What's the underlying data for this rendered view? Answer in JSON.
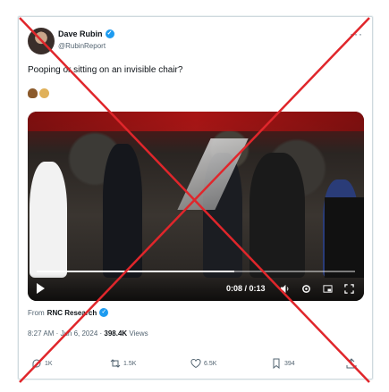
{
  "post": {
    "author": "Dave Rubin",
    "handle": "@RubinReport",
    "more": "···",
    "text": "Pooping or sitting on an invisible chair?",
    "emojis": [
      "poop-emoji",
      "person-emoji"
    ]
  },
  "video": {
    "time": "0:08 / 0:13",
    "progress": 0.62
  },
  "source": {
    "prefix": "From",
    "name": "RNC Research"
  },
  "meta": {
    "time": "8:27 AM",
    "date": "Jun 6, 2024",
    "views_count": "398.4K",
    "views_label": "Views"
  },
  "actions": {
    "replies": "1K",
    "reposts": "1.5K",
    "likes": "6.5K",
    "bookmarks": "394"
  },
  "colors": {
    "accent": "#1d9bf0",
    "cross": "#e0262b"
  }
}
